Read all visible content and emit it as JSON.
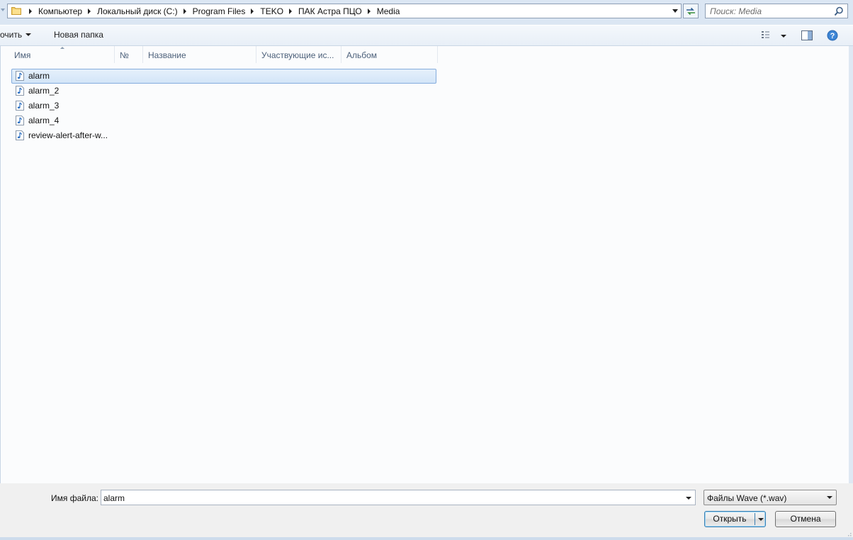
{
  "address": {
    "crumbs": [
      "Компьютер",
      "Локальный диск (C:)",
      "Program Files",
      "TEKO",
      "ПАК Астра ПЦО",
      "Media"
    ]
  },
  "search": {
    "placeholder": "Поиск: Media"
  },
  "toolbar": {
    "organize_label": "очить",
    "new_folder_label": "Новая папка"
  },
  "columns": [
    "Имя",
    "№",
    "Название",
    "Участвующие ис...",
    "Альбом"
  ],
  "files": [
    {
      "name": "alarm",
      "selected": true
    },
    {
      "name": "alarm_2",
      "selected": false
    },
    {
      "name": "alarm_3",
      "selected": false
    },
    {
      "name": "alarm_4",
      "selected": false
    },
    {
      "name": "review-alert-after-w...",
      "selected": false
    }
  ],
  "bottom": {
    "file_name_label": "Имя файла:",
    "file_name_value": "alarm",
    "file_type": "Файлы Wave (*.wav)",
    "open_label": "Открыть",
    "cancel_label": "Отмена"
  },
  "icons": {
    "folder": "folder-icon",
    "refresh": "refresh-icon",
    "search": "search-icon",
    "views": "views-icon",
    "preview": "preview-pane-icon",
    "help": "help-icon",
    "audio_file": "audio-file-icon"
  },
  "colors": {
    "selection_border": "#84acdd",
    "selection_fill": "#d3e5f8",
    "help_blue": "#2d6cb5"
  }
}
